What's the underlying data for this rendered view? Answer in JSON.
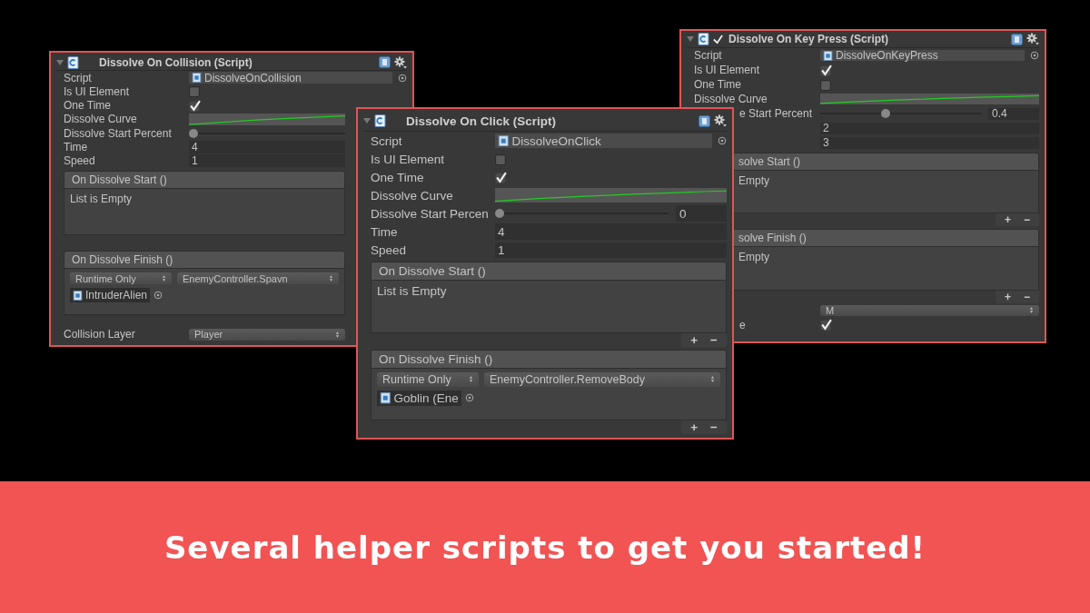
{
  "panels": [
    {
      "title": "Dissolve On Collision (Script)",
      "fields": [
        {
          "kind": "object",
          "label": "Script",
          "value": "DissolveOnCollision"
        },
        {
          "kind": "checkbox",
          "label": "Is UI Element",
          "checked": false
        },
        {
          "kind": "checkbox",
          "label": "One Time",
          "checked": true
        },
        {
          "kind": "curve",
          "label": "Dissolve Curve"
        },
        {
          "kind": "slider",
          "label": "Dissolve Start Percent",
          "level": 0
        },
        {
          "kind": "number",
          "label": "Time",
          "value": "4"
        },
        {
          "kind": "number",
          "label": "Speed",
          "value": "1"
        },
        {
          "kind": "event",
          "title": "On Dissolve Start ()",
          "empty_text": "List is Empty"
        },
        {
          "kind": "event",
          "title": "On Dissolve Finish ()",
          "entries": [
            {
              "mode": "Runtime Only",
              "function": "EnemyController.Spavn",
              "target": "IntruderAlien"
            }
          ]
        },
        {
          "kind": "dropdown",
          "label": "Collision Layer",
          "value": "Player"
        }
      ]
    },
    {
      "title": "Dissolve On Click (Script)",
      "fields": [
        {
          "kind": "object",
          "label": "Script",
          "value": "DissolveOnClick"
        },
        {
          "kind": "checkbox",
          "label": "Is UI Element",
          "checked": false
        },
        {
          "kind": "checkbox",
          "label": "One Time",
          "checked": true
        },
        {
          "kind": "curve",
          "label": "Dissolve Curve"
        },
        {
          "kind": "slider",
          "label": "Dissolve Start Percen",
          "level": 0,
          "reading": "0"
        },
        {
          "kind": "number",
          "label": "Time",
          "value": "4"
        },
        {
          "kind": "number",
          "label": "Speed",
          "value": "1"
        },
        {
          "kind": "event",
          "title": "On Dissolve Start ()",
          "empty_text": "List is Empty",
          "buttons": [
            "+",
            "−"
          ]
        },
        {
          "kind": "event",
          "title": "On Dissolve Finish ()",
          "entries": [
            {
              "mode": "Runtime Only",
              "function": "EnemyController.RemoveBody",
              "target": "Goblin (Ene"
            }
          ],
          "buttons": [
            "+",
            "−"
          ]
        }
      ]
    },
    {
      "title": "Dissolve On Key Press (Script)",
      "enabled": true,
      "fields": [
        {
          "kind": "object",
          "label": "Script",
          "value": "DissolveOnKeyPress"
        },
        {
          "kind": "checkbox",
          "label": "Is UI Element",
          "checked": true
        },
        {
          "kind": "checkbox",
          "label": "One Time",
          "checked": false
        },
        {
          "kind": "curve",
          "label": "Dissolve Curve"
        },
        {
          "kind": "slider",
          "label": "e Start Percent",
          "level": 0.4,
          "reading": "0.4"
        },
        {
          "kind": "number",
          "value": "2"
        },
        {
          "kind": "number",
          "value": "3"
        },
        {
          "kind": "event",
          "title": "solve Start ()",
          "empty_text": "Empty",
          "buttons": [
            "+",
            "−"
          ]
        },
        {
          "kind": "event",
          "title": "solve Finish ()",
          "empty_text": "Empty",
          "buttons": [
            "+",
            "−"
          ]
        },
        {
          "kind": "dropdown",
          "value": "M"
        },
        {
          "kind": "checkbox",
          "label": "e",
          "checked": true
        }
      ]
    }
  ],
  "banner": {
    "text": "Several helper scripts to get you started!"
  }
}
